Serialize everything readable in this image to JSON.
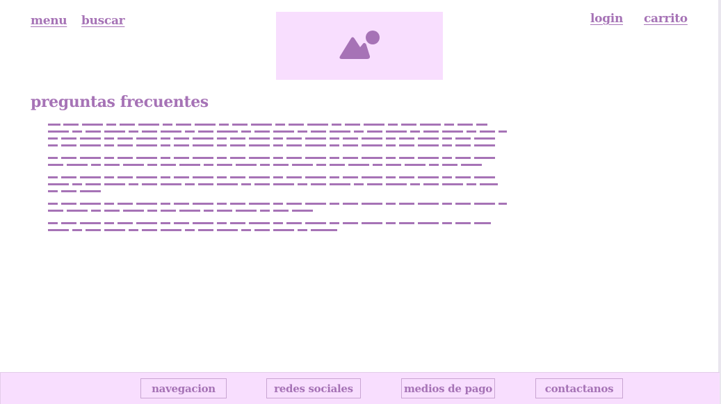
{
  "header": {
    "menu_label": "menu",
    "search_label": "buscar",
    "login_label": "login",
    "cart_label": "carrito",
    "logo_icon": "image-placeholder-icon"
  },
  "main": {
    "title": "preguntas frecuentes",
    "faq_items": [
      {
        "kind": "placeholder-text",
        "lines": 3
      },
      {
        "kind": "placeholder-text",
        "lines": 2
      },
      {
        "kind": "placeholder-text",
        "lines": 3
      },
      {
        "kind": "placeholder-text",
        "lines": 2
      },
      {
        "kind": "placeholder-text",
        "lines": 2
      }
    ]
  },
  "footer": {
    "buttons": [
      "navegacion",
      "redes sociales",
      "medios de pago",
      "contactanos"
    ]
  },
  "colors": {
    "accent": "#a673b6",
    "panel": "#f8defe",
    "border": "#c8a4d2",
    "background": "#ffffff"
  }
}
